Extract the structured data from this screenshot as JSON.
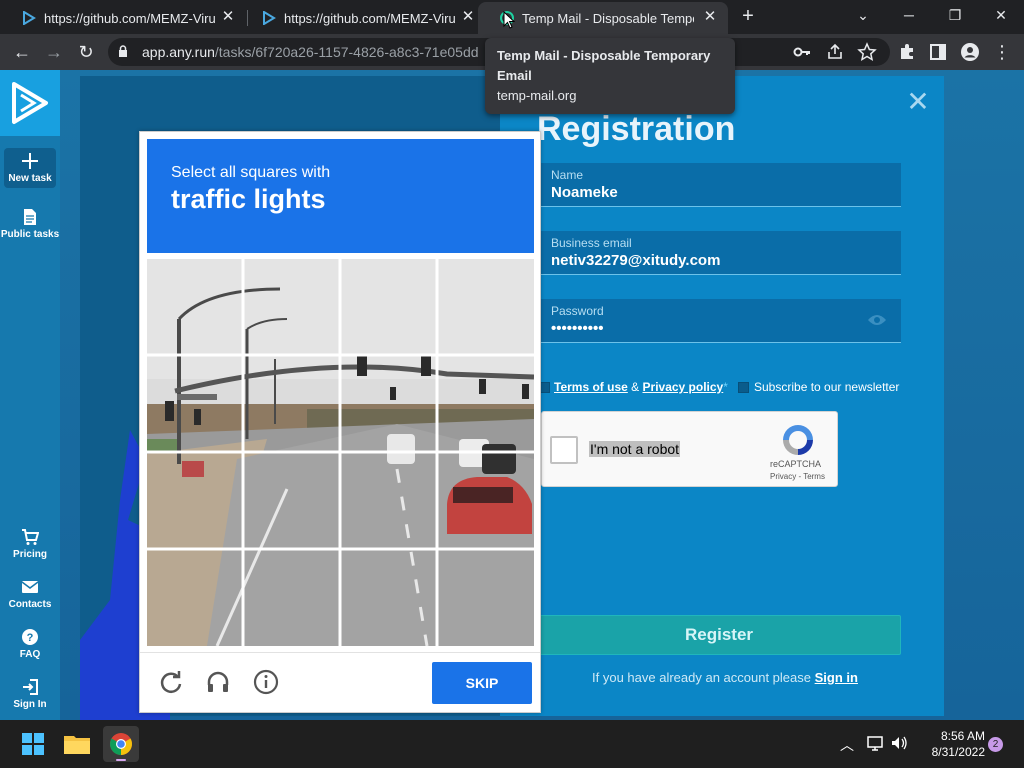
{
  "browser": {
    "tabs": [
      {
        "title": "https://github.com/MEMZ-Virus-"
      },
      {
        "title": "https://github.com/MEMZ-Virus-"
      },
      {
        "title": "Temp Mail - Disposable Tempora"
      }
    ],
    "url_main": "app.any.run",
    "url_path": "/tasks/6f720a26-1157-4826-a8c3-71e05dd",
    "tooltip": {
      "title": "Temp Mail - Disposable Temporary Email",
      "domain": "temp-mail.org"
    }
  },
  "sidebar": {
    "items": [
      {
        "label": "New task"
      },
      {
        "label": "Public tasks"
      },
      {
        "label": "Pricing"
      },
      {
        "label": "Contacts"
      },
      {
        "label": "FAQ"
      },
      {
        "label": "Sign In"
      }
    ]
  },
  "registration": {
    "title": "Registration",
    "fields": [
      {
        "label": "Name",
        "value": "Noameke"
      },
      {
        "label": "Business email",
        "value": "netiv32279@xitudy.com"
      },
      {
        "label": "Password",
        "value": "••••••••••"
      }
    ],
    "terms_link": "Terms of use",
    "amp": "&",
    "privacy_link": "Privacy policy",
    "required_mark": "*",
    "newsletter_label": "Subscribe to our newsletter",
    "recaptcha": {
      "label": "I'm not a robot",
      "brand": "reCAPTCHA",
      "links": "Privacy - Terms"
    },
    "register_button": "Register",
    "signin_prefix": "If you have already an account please",
    "signin_link": "Sign in"
  },
  "captcha_challenge": {
    "instruction": "Select all squares with",
    "target": "traffic lights",
    "skip_label": "SKIP"
  },
  "taskbar": {
    "time": "8:56 AM",
    "date": "8/31/2022",
    "notification_count": "2"
  }
}
